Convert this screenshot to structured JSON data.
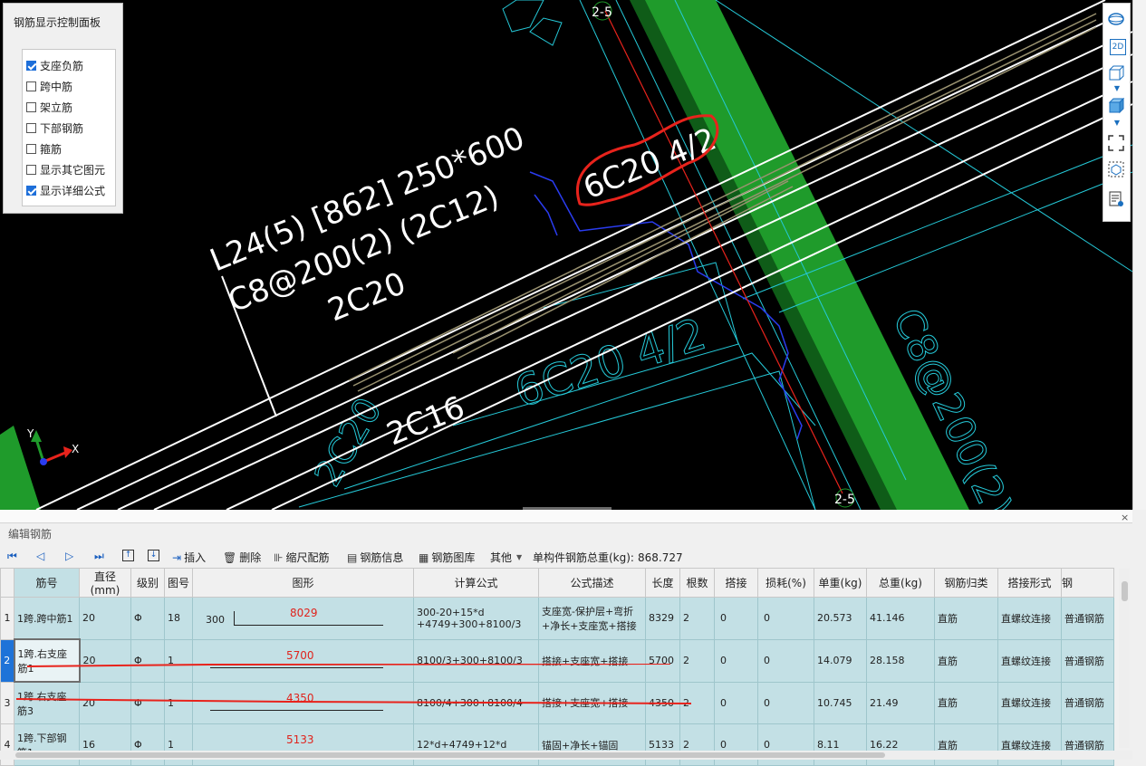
{
  "cad": {
    "axis_label_top": "2-5",
    "axis_label_bottom": "2-5",
    "beam_label_line1": "L24(5) [862] 250*600",
    "beam_label_line2": "C8@200(2) (2C12)",
    "beam_label_line3": "2C20",
    "bottom_rebar_label": "2C16",
    "support_rebar_label": "6C20 4/2",
    "ghost_label_1": "6C20 4/2",
    "ghost_label_2": "2C20",
    "ghost_label_3": "C8@200(2)",
    "axis_x": "X",
    "axis_y": "Y",
    "colors": {
      "beam_green": "#1f9b2b",
      "annotation_red": "#e8231c",
      "cyan": "#25c9d8",
      "blue": "#2a3cf0"
    }
  },
  "control_panel": {
    "title": "钢筋显示控制面板",
    "options": [
      {
        "label": "支座负筋",
        "checked": true
      },
      {
        "label": "跨中筋",
        "checked": false
      },
      {
        "label": "架立筋",
        "checked": false
      },
      {
        "label": "下部钢筋",
        "checked": false
      },
      {
        "label": "箍筋",
        "checked": false
      },
      {
        "label": "显示其它图元",
        "checked": false
      },
      {
        "label": "显示详细公式",
        "checked": true
      }
    ]
  },
  "right_toolbar": {
    "icons": [
      "globe-icon",
      "2d-view-icon",
      "cube-wire-icon",
      "chevron-down-icon",
      "cube-solid-icon",
      "chevron-down-icon",
      "fullscreen-icon",
      "cube-select-icon",
      "report-icon"
    ],
    "label_2d": "2D"
  },
  "edit_panel": {
    "title": "编辑钢筋",
    "close": "×",
    "toolbar": {
      "insert": "插入",
      "delete": "删除",
      "scale": "缩尺配筋",
      "info": "钢筋信息",
      "library": "钢筋图库",
      "other": "其他",
      "total_label": "单构件钢筋总重(kg):",
      "total_value": "868.727"
    },
    "columns": [
      "筋号",
      "直径(mm)",
      "级别",
      "图号",
      "图形",
      "计算公式",
      "公式描述",
      "长度",
      "根数",
      "搭接",
      "损耗(%)",
      "单重(kg)",
      "总重(kg)",
      "钢筋归类",
      "搭接形式",
      "钢"
    ],
    "rows": [
      {
        "n": "1",
        "name": "1跨.跨中筋1",
        "dia": "20",
        "grade": "Φ",
        "fig": "18",
        "shape_left": "300",
        "shape_num": "8029",
        "formula": "300-20+15*d +4749+300+8100/3",
        "desc": "支座宽-保护层+弯折 +净长+支座宽+搭接",
        "len": "8329",
        "count": "2",
        "lap": "0",
        "loss": "0",
        "unit": "20.573",
        "total": "41.146",
        "cat": "直筋",
        "laptype": "直螺纹连接",
        "type": "普通钢筋"
      },
      {
        "n": "2",
        "name": "1跨.右支座筋1",
        "dia": "20",
        "grade": "Φ",
        "fig": "1",
        "shape_left": "",
        "shape_num": "5700",
        "formula": "8100/3+300+8100/3",
        "desc": "搭接+支座宽+搭接",
        "len": "5700",
        "count": "2",
        "lap": "0",
        "loss": "0",
        "unit": "14.079",
        "total": "28.158",
        "cat": "直筋",
        "laptype": "直螺纹连接",
        "type": "普通钢筋"
      },
      {
        "n": "3",
        "name": "1跨.右支座筋3",
        "dia": "20",
        "grade": "Φ",
        "fig": "1",
        "shape_left": "",
        "shape_num": "4350",
        "formula": "8100/4+300+8100/4",
        "desc": "搭接+支座宽+搭接",
        "len": "4350",
        "count": "2",
        "lap": "0",
        "loss": "0",
        "unit": "10.745",
        "total": "21.49",
        "cat": "直筋",
        "laptype": "直螺纹连接",
        "type": "普通钢筋"
      },
      {
        "n": "4",
        "name": "1跨.下部钢筋1",
        "dia": "16",
        "grade": "Φ",
        "fig": "1",
        "shape_left": "",
        "shape_num": "5133",
        "formula": "12*d+4749+12*d",
        "desc": "锚固+净长+锚固",
        "len": "5133",
        "count": "2",
        "lap": "0",
        "loss": "0",
        "unit": "8.11",
        "total": "16.22",
        "cat": "直筋",
        "laptype": "直螺纹连接",
        "type": "普通钢筋"
      }
    ]
  }
}
